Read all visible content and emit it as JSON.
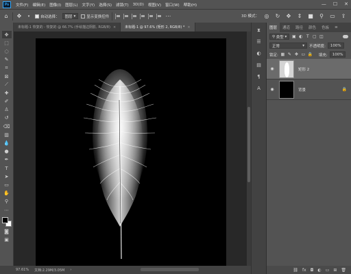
{
  "menu": {
    "logo": "Ps",
    "items": [
      "文件(F)",
      "编辑(E)",
      "图像(I)",
      "图层(L)",
      "文字(Y)",
      "选择(S)",
      "滤镜(T)",
      "3D(D)",
      "视图(V)",
      "窗口(W)",
      "帮助(H)"
    ],
    "window_controls": [
      "—",
      "☐",
      "✕"
    ]
  },
  "options": {
    "auto_select_label": "自动选择：",
    "auto_select_value": "图层",
    "show_transform_label": "显示变换控件",
    "mode_3d_label": "3D 模式："
  },
  "tabs": [
    {
      "label": "未标题-1 恢复的 - 恢复的 @ 66.7% (手绘描边阴影, RGB/8)",
      "close": "×"
    },
    {
      "label": "未标题-1 @ 97.6% (矩形 2, RGB/8) *",
      "close": "×"
    }
  ],
  "status": {
    "zoom": "97.61%",
    "doc_size": "文档:2.29M/3.05M"
  },
  "layers_panel": {
    "tabs": [
      "图层",
      "通道",
      "路径",
      "颜色",
      "色板"
    ],
    "filter_label": "类型",
    "blend_mode": "正常",
    "opacity_label": "不透明度:",
    "opacity_value": "100%",
    "lock_label": "锁定:",
    "fill_label": "填充:",
    "fill_value": "100%",
    "layers": [
      {
        "name": "矩形 2",
        "selected": true
      },
      {
        "name": "背景",
        "selected": false,
        "locked": true
      }
    ]
  },
  "colors": {
    "accent": "#31a8ff",
    "feather": "#ffffff",
    "canvas": "#000000"
  }
}
